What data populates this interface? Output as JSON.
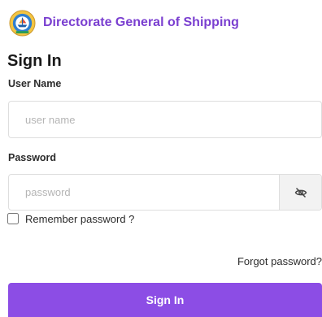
{
  "brand": {
    "title": "Directorate General of Shipping",
    "logo_icon": "emblem-icon",
    "color": "#7a3fd0"
  },
  "heading": "Sign In",
  "username": {
    "label": "User Name",
    "placeholder": "user name",
    "value": ""
  },
  "password": {
    "label": "Password",
    "placeholder": "password",
    "value": "",
    "toggle_icon": "eye-slash-icon"
  },
  "remember": {
    "label": "Remember password ?",
    "checked": false
  },
  "forgot_label": "Forgot password?",
  "submit_label": "Sign In",
  "colors": {
    "accent": "#8c4de5",
    "field_border": "#dedede",
    "toggle_bg": "#f2f2f2"
  }
}
